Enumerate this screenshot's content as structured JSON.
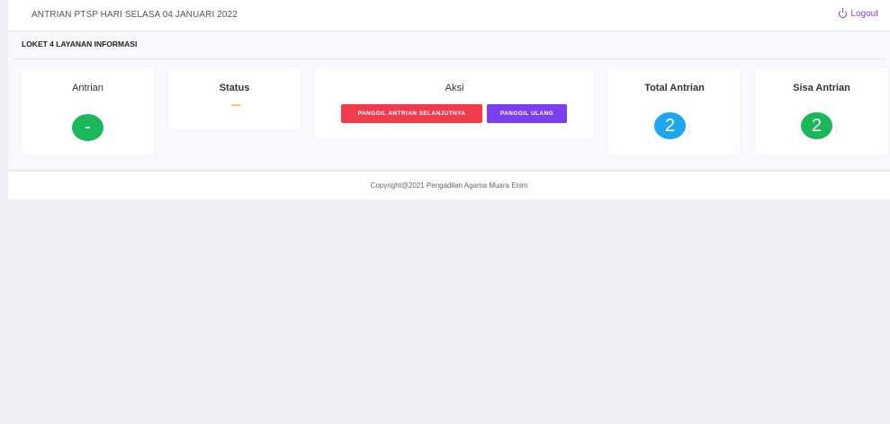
{
  "header": {
    "title": "ANTRIAN PTSP HARI SELASA 04 JANUARI 2022",
    "logout_label": "Logout"
  },
  "loket": {
    "title": "LOKET 4 LAYANAN INFORMASI"
  },
  "cards": {
    "antrian": {
      "title": "Antrian",
      "value": "-"
    },
    "status": {
      "title": "Status",
      "value": ""
    },
    "aksi": {
      "title": "Aksi",
      "next_button": "PANGGIL ANTRIAN SELANJUTNYA",
      "recall_button": "PANGGIL ULANG"
    },
    "total": {
      "title": "Total Antrian",
      "value": "2"
    },
    "sisa": {
      "title": "Sisa Antrian",
      "value": "2"
    }
  },
  "footer": {
    "copyright": "Copyright@2021 Pengadilan Agama Muara Enim"
  },
  "colors": {
    "green": "#1ab85a",
    "blue": "#1ea7ee",
    "red": "#ef3b4b",
    "purple": "#7b3ff0"
  }
}
